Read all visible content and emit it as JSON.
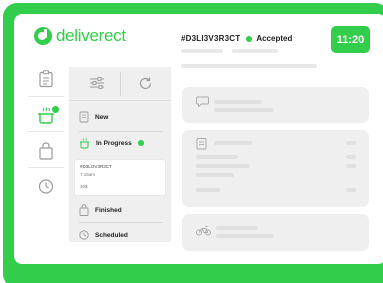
{
  "brand": {
    "name": "deliverect"
  },
  "header": {
    "order_id": "#D3LI3V3R3CT",
    "status": "Accepted",
    "time": "11:20"
  },
  "sidebar": {
    "items": [
      {
        "icon": "orders-icon"
      },
      {
        "icon": "cooking-pot-icon",
        "active": true
      },
      {
        "icon": "bag-icon"
      },
      {
        "icon": "history-icon"
      }
    ]
  },
  "order_list": {
    "sections": [
      {
        "label": "New",
        "icon": "receipt-icon"
      },
      {
        "label": "In Progress",
        "icon": "cooking-pot-icon"
      },
      {
        "label": "Finished",
        "icon": "bag-icon"
      },
      {
        "label": "Scheduled",
        "icon": "clock-icon"
      }
    ],
    "active_order": {
      "id": "#D3LI3V3R3CT",
      "time": "7:15am",
      "price": "30$"
    }
  },
  "details": {
    "cards": [
      {
        "icon": "chat-icon"
      },
      {
        "icon": "receipt-icon"
      },
      {
        "icon": "bike-icon"
      }
    ]
  },
  "colors": {
    "accent": "#32cd4b",
    "panel": "#efefef",
    "skeleton": "#e8e8e8"
  }
}
